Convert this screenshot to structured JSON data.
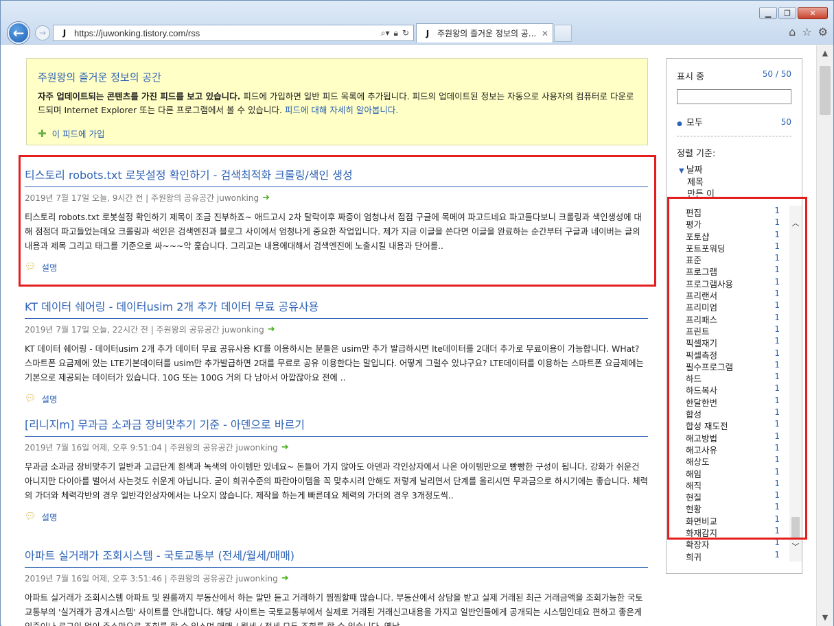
{
  "browser": {
    "url": "https://juwonking.tistory.com/rss",
    "favicon": "J",
    "tab_title": "주원왕의 즐거운 정보의 공...",
    "tab_close": "✕",
    "window_controls": [
      "minimize",
      "maximize",
      "close"
    ]
  },
  "feed": {
    "title": "주원왕의 즐거운 정보의 공간",
    "desc_bold": "자주 업데이트되는 콘텐츠를 가진 피드를 보고 있습니다.",
    "desc_text": " 피드에 가입하면 일반 피드 목록에 추가됩니다. 피드의 업데이트된 정보는 자동으로 사용자의 컴퓨터로 다운로드되며 Internet Explorer 또는 다른 프로그램에서 볼 수 있습니다. ",
    "desc_link": "피드에 대해 자세히 알아봅니다.",
    "subscribe": "이 피드에 가입"
  },
  "articles": [
    {
      "title": "티스토리 robots.txt 로봇설정 확인하기 - 검색최적화 크롤링/색인 생성",
      "meta": "2019년 7월 17일 오늘, 9시간 전 | 주원왕의 공유공간 juwonking",
      "body": "티스토리 robots.txt 로봇설정 확인하기 제목이 조금 진부하죠~ 애드고시 2차 탈락이후 짜증이 엄청나서 점점 구글에 목메여 파고드네요 파고들다보니 크롤링과 색인생성에 대해 점점더 파고들었는데요 크롤링과 색인은 검색엔진과 블로그 사이에서 엄청나게 중요한 작업입니다. 제가 지금 이글을 쓴다면 이글을 완료하는 순간부터 구글과 네이버는 글의 내용과 제목 그리고 태그를 기준으로 싸~~~악 훑습니다. 그리고는 내용에대해서 검색엔진에 노출시킬 내용과 단어를..",
      "desc_label": "설명"
    },
    {
      "title": "KT 데이터 쉐어링 - 데이터usim 2개 추가 데이터 무료 공유사용",
      "meta": "2019년 7월 17일 오늘, 22시간 전 | 주원왕의 공유공간 juwonking",
      "body": "KT 데이터 쉐어링 - 데이터usim 2개 추가 데이터 무료 공유사용 KT를 이용하시는 분들은 usim만 추가 발급하시면 lte데이터를 2대더 추가로 무료이용이 가능합니다. WHat? 스마트폰 요금제에 있는 LTE기본데이터를 usim만 추가발급하면 2대를 무료로 공유 이용한다는 말입니다. 어떻게 그럴수 있냐구요? LTE데이터를 이용하는 스마트폰 요금제에는 기본으로 제공되는 데이터가 있습니다. 10G 또는 100G 거의 다 남아서 아깝잖아요 전에 ..",
      "desc_label": "설명"
    },
    {
      "title": "[리니지m] 무과금 소과금 장비맞추기 기준 - 아덴으로 바르기",
      "meta": "2019년 7월 16일 어제, 오후 9:51:04 | 주원왕의 공유공간 juwonking",
      "body": "무과금 소과금 장비맞추기 일반과 고급단계 흰색과 녹색의 아이템만 있네요~ 돈들어 가지 않아도 아덴과 각인상자에서 나온 아이템만으로 빵빵한 구성이 됩니다. 강화가 쉬운건 아니지만 다이아를 벌어서 사는것도 쉬운게 아닙니다. 굳이 희귀수준의 파란아이템을 꼭 맞추시려 안해도 저렇게 날리면서 단계를 올리시면 무과금으로 하시기에는 좋습니다. 체력의 가더와 체력각반의 경우 일반각인상자에서는 나오지 않습니다. 제작을 하는게 빠른데요 체력의 가더의 경우 3개정도씩..",
      "desc_label": "설명"
    },
    {
      "title": "아파트 실거래가 조회시스템 - 국토교통부 (전세/월세/매매)",
      "meta": "2019년 7월 16일 어제, 오후 3:51:46 | 주원왕의 공유공간 juwonking",
      "body": "아파트 실거래가 조회시스템 아파트 및 원룸까지 부동산에서 하는 말만 듣고 거래하기 찜찜할때 많습니다. 부동산에서 상담을 받고 실제 거래된 최근 거래금액을 조회가능한 국토교통부의 '실거래가 공개시스템' 사이트를 안내합니다. 해당 사이트는 국토교통부에서 실제로 거래된 거래신고내용을 가지고 일반인들에게 공개되는 시스템인데요 편하고 좋은게 인증이나 로그인 없이 주소만으로 조회를 할 수 있스며 매매 / 월세 / 전세 모두 조회를 할 수 있습니다. 옛날",
      "desc_label": "설명"
    }
  ],
  "panel": {
    "showing_label": "표시 중",
    "showing_count": "50 / 50",
    "all_label": "모두",
    "all_count": "50",
    "sort_label": "정렬 기준:",
    "sort_options": [
      "날짜",
      "제목",
      "만든 이"
    ],
    "categories": [
      {
        "name": "편집",
        "count": "1"
      },
      {
        "name": "평가",
        "count": "1"
      },
      {
        "name": "포토샵",
        "count": "1"
      },
      {
        "name": "포트포워딩",
        "count": "1"
      },
      {
        "name": "표준",
        "count": "1"
      },
      {
        "name": "프로그램",
        "count": "1"
      },
      {
        "name": "프로그램사용",
        "count": "1"
      },
      {
        "name": "프리랜서",
        "count": "1"
      },
      {
        "name": "프리미엄",
        "count": "1"
      },
      {
        "name": "프리패스",
        "count": "1"
      },
      {
        "name": "프린트",
        "count": "1"
      },
      {
        "name": "픽셀재기",
        "count": "1"
      },
      {
        "name": "픽셀측정",
        "count": "1"
      },
      {
        "name": "필수프로그램",
        "count": "1"
      },
      {
        "name": "하드",
        "count": "1"
      },
      {
        "name": "하드복사",
        "count": "1"
      },
      {
        "name": "한달한번",
        "count": "1"
      },
      {
        "name": "합성",
        "count": "1"
      },
      {
        "name": "합성 재도전",
        "count": "1"
      },
      {
        "name": "해고방법",
        "count": "1"
      },
      {
        "name": "해고사유",
        "count": "1"
      },
      {
        "name": "해상도",
        "count": "1"
      },
      {
        "name": "해임",
        "count": "1"
      },
      {
        "name": "해직",
        "count": "1"
      },
      {
        "name": "현질",
        "count": "1"
      },
      {
        "name": "현황",
        "count": "1"
      },
      {
        "name": "화면비교",
        "count": "1"
      },
      {
        "name": "화재감지",
        "count": "1"
      },
      {
        "name": "확장자",
        "count": "1"
      },
      {
        "name": "희귀",
        "count": "1"
      }
    ]
  },
  "colors": {
    "link": "#2e63b5",
    "highlight": "#e41e1e",
    "feed_bg": "#ffffc6"
  }
}
